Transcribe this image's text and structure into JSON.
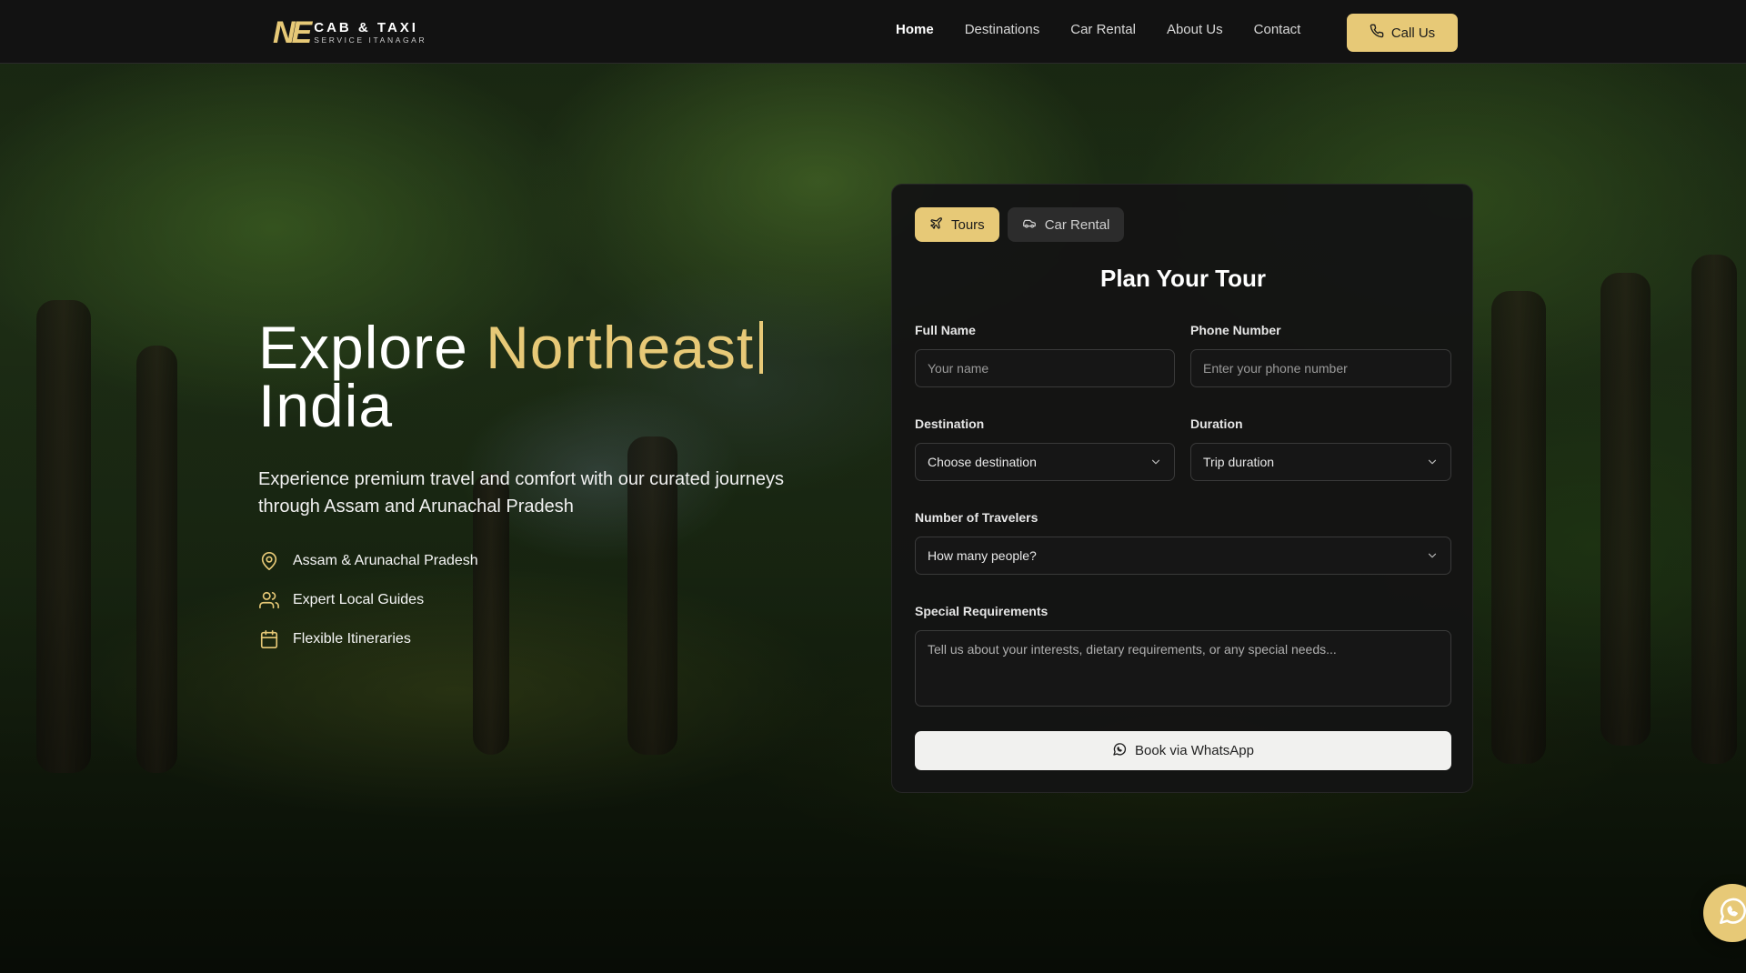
{
  "brand": {
    "mark": "NE",
    "line1": "CAB & TAXI",
    "line2": "SERVICE ITANAGAR",
    "accent_color": "#e7c977"
  },
  "nav": {
    "links": [
      {
        "label": "Home",
        "active": true
      },
      {
        "label": "Destinations",
        "active": false
      },
      {
        "label": "Car Rental",
        "active": false
      },
      {
        "label": "About Us",
        "active": false
      },
      {
        "label": "Contact",
        "active": false
      }
    ],
    "call_label": "Call Us",
    "call_icon": "phone-icon"
  },
  "hero": {
    "title_prefix": "Explore",
    "title_accent": "Northeast",
    "title_suffix": "India",
    "subtitle": "Experience premium travel and comfort with our curated journeys through Assam and Arunachal Pradesh",
    "features": [
      {
        "icon": "map-pin-icon",
        "label": "Assam & Arunachal Pradesh"
      },
      {
        "icon": "users-icon",
        "label": "Expert Local Guides"
      },
      {
        "icon": "calendar-icon",
        "label": "Flexible Itineraries"
      }
    ]
  },
  "form": {
    "tabs": [
      {
        "label": "Tours",
        "icon": "plane-icon",
        "active": true
      },
      {
        "label": "Car Rental",
        "icon": "car-icon",
        "active": false
      }
    ],
    "title": "Plan Your Tour",
    "full_name": {
      "label": "Full Name",
      "placeholder": "Your name"
    },
    "phone": {
      "label": "Phone Number",
      "placeholder": "Enter your phone number"
    },
    "destination": {
      "label": "Destination",
      "value": "Choose destination"
    },
    "duration": {
      "label": "Duration",
      "value": "Trip duration"
    },
    "travelers": {
      "label": "Number of Travelers",
      "value": "How many people?"
    },
    "requirements": {
      "label": "Special Requirements",
      "placeholder": "Tell us about your interests, dietary requirements, or any special needs..."
    },
    "submit_label": "Book via WhatsApp",
    "submit_icon": "whatsapp-icon"
  },
  "floating_button": {
    "icon": "whatsapp-icon"
  }
}
